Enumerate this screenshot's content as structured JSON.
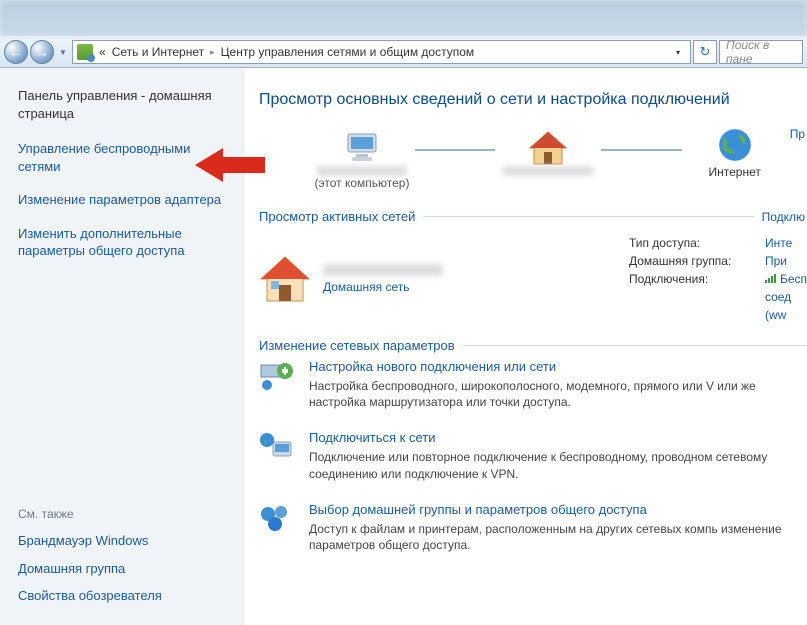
{
  "address": {
    "segment1": "Сеть и Интернет",
    "segment2": "Центр управления сетями и общим доступом",
    "search_placeholder": "Поиск в пане"
  },
  "sidebar": {
    "home": "Панель управления - домашняя страница",
    "links": [
      "Управление беспроводными сетями",
      "Изменение параметров адаптера",
      "Изменить дополнительные параметры общего доступа"
    ],
    "see_also_header": "См. также",
    "see_also": [
      "Брандмауэр Windows",
      "Домашняя группа",
      "Свойства обозревателя"
    ]
  },
  "content": {
    "heading": "Просмотр основных сведений о сети и настройка подключений",
    "map": {
      "this_computer": "(этот компьютер)",
      "internet": "Интернет",
      "full_map_link": "Пр"
    },
    "active_header": "Просмотр активных сетей",
    "active_connect_link": "Подклю",
    "active_net": {
      "type_link": "Домашняя сеть",
      "props": {
        "access_label": "Тип доступа:",
        "access_value": "Инте",
        "homegroup_label": "Домашняя группа:",
        "homegroup_value": "При",
        "conn_label": "Подключения:",
        "conn_value": "Бесп",
        "conn_value2": "соед",
        "conn_value3": "(ww"
      }
    },
    "change_header": "Изменение сетевых параметров",
    "items": [
      {
        "title": "Настройка нового подключения или сети",
        "desc": "Настройка беспроводного, широкополосного, модемного, прямого или V или же настройка маршрутизатора или точки доступа."
      },
      {
        "title": "Подключиться к сети",
        "desc": "Подключение или повторное подключение к беспроводному, проводном сетевому соединению или подключение к VPN."
      },
      {
        "title": "Выбор домашней группы и параметров общего доступа",
        "desc": "Доступ к файлам и принтерам, расположенным на других сетевых компь изменение параметров общего доступа."
      }
    ]
  }
}
